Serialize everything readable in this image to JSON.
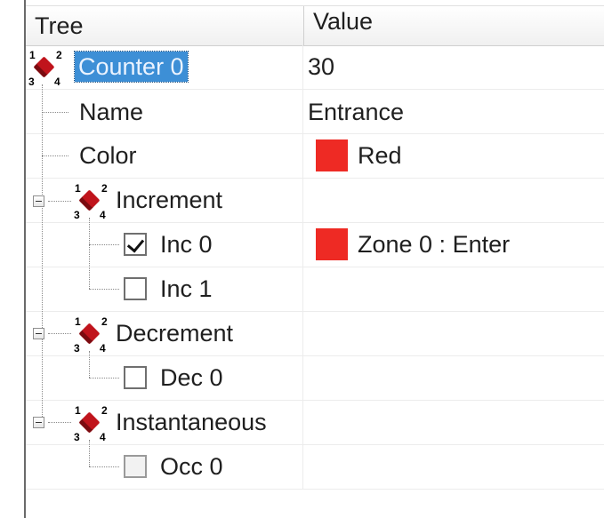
{
  "columns": {
    "tree": "Tree",
    "value": "Value"
  },
  "colors": {
    "red_swatch": "#ee2a24",
    "selection": "#3d8fd6"
  },
  "rows": [
    {
      "label": "Counter 0",
      "value": "30",
      "icon": "counter-node-icon",
      "numbers": [
        "1",
        "2",
        "3",
        "4"
      ]
    },
    {
      "label": "Name",
      "value": "Entrance"
    },
    {
      "label": "Color",
      "value": "Red"
    },
    {
      "label": "Increment",
      "value": "",
      "icon": "counter-node-icon",
      "numbers": [
        "1",
        "2",
        "3",
        "4"
      ]
    },
    {
      "label": "Inc 0",
      "value": "Zone 0 : Enter",
      "checked": true
    },
    {
      "label": "Inc 1",
      "value": "",
      "checked": false
    },
    {
      "label": "Decrement",
      "value": "",
      "icon": "counter-node-icon",
      "numbers": [
        "1",
        "2",
        "3",
        "4"
      ]
    },
    {
      "label": "Dec 0",
      "value": "",
      "checked": false
    },
    {
      "label": "Instantaneous",
      "value": "",
      "icon": "counter-node-icon",
      "numbers": [
        "1",
        "2",
        "3",
        "4"
      ]
    },
    {
      "label": "Occ 0",
      "value": "",
      "checked": false,
      "disabled": true
    }
  ]
}
